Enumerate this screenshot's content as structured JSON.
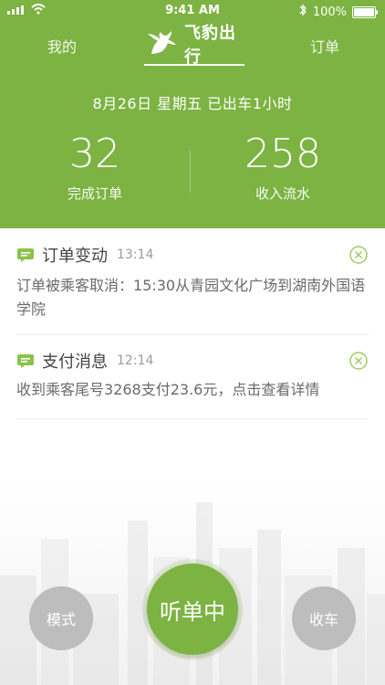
{
  "status_bar": {
    "time": "9:41 AM",
    "battery_text": "100%",
    "icons": [
      "signal-icon",
      "wifi-icon",
      "bluetooth-icon",
      "battery-icon"
    ]
  },
  "nav": {
    "left_tab": "我的",
    "brand": "飞豹出行",
    "right_tab": "订单"
  },
  "summary": {
    "date_line": "8月26日  星期五  已出车1小时",
    "completed_orders_value": "32",
    "completed_orders_label": "完成订单",
    "income_value": "258",
    "income_label": "收入流水"
  },
  "messages": [
    {
      "title": "订单变动",
      "time": "13:14",
      "body": "订单被乘客取消：15:30从青园文化广场到湖南外国语学院"
    },
    {
      "title": "支付消息",
      "time": "12:14",
      "body": "收到乘客尾号3268支付23.6元，点击查看详情"
    }
  ],
  "buttons": {
    "mode": "模式",
    "listen": "听单中",
    "stop": "收车"
  },
  "colors": {
    "primary_green": "#7cb342",
    "gray_button": "#bdbdbd"
  }
}
